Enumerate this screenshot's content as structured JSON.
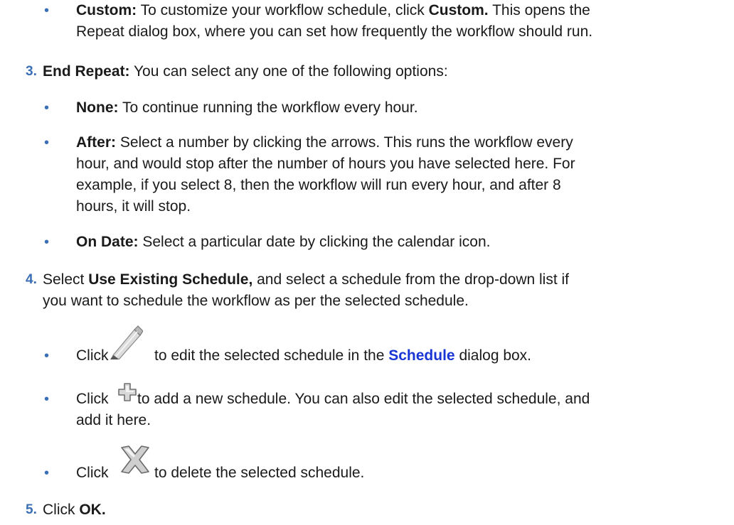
{
  "colors": {
    "marker": "#3a6fb5",
    "link": "#1a35d6",
    "text": "#1a1a1a"
  },
  "items": {
    "custom": {
      "bullet": "•",
      "term": "Custom:",
      "text1": " To customize your workflow schedule, click ",
      "bold1": "Custom.",
      "text2": " This opens the",
      "line2": "Repeat dialog box, where you can set how frequently the workflow should run."
    },
    "step3": {
      "number": "3.",
      "term": "End Repeat:",
      "text": " You can select any one of the following options:"
    },
    "none": {
      "bullet": "•",
      "term": "None:",
      "text": " To continue running the workflow every hour."
    },
    "after": {
      "bullet": "•",
      "term": "After:",
      "text1": " Select a number by clicking the arrows. This runs the workflow every",
      "line2": "hour, and would stop after the number of hours you have selected here. For",
      "line3": "example, if you select 8, then the workflow will run every hour, and after 8",
      "line4": "hours, it will stop."
    },
    "ondate": {
      "bullet": "•",
      "term": "On Date:",
      "text": " Select a particular date by clicking the calendar icon."
    },
    "step4": {
      "number": "4.",
      "text1": "Select ",
      "bold1": "Use Existing Schedule,",
      "text2": " and select a schedule from the drop-down list if",
      "line2": "you want to schedule the workflow as per the selected schedule."
    },
    "edit": {
      "bullet": "•",
      "click": "Click",
      "icon": "pencil-icon",
      "text1": "to edit the selected schedule in the ",
      "link": "Schedule",
      "text2": " dialog box."
    },
    "add": {
      "bullet": "•",
      "click": "Click",
      "icon": "plus-icon",
      "text1": "to add a new schedule. You can also edit the selected schedule, and",
      "line2": "add it here."
    },
    "delete": {
      "bullet": "•",
      "click": "Click",
      "icon": "delete-x-icon",
      "text1": "to delete the selected schedule."
    },
    "step5": {
      "number": "5.",
      "text1": "Click ",
      "bold1": "OK."
    }
  }
}
